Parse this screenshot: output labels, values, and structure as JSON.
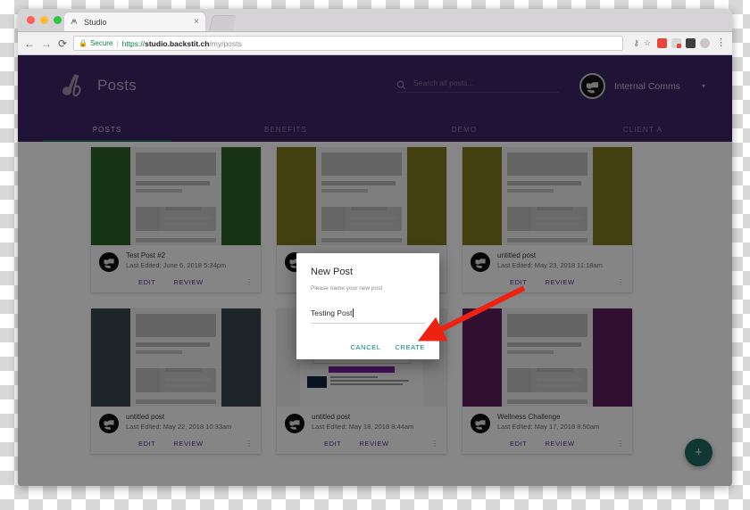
{
  "browser": {
    "tab_title": "Studio",
    "tab_close": "×",
    "back_icon": "back-arrow-icon",
    "forward_icon": "forward-arrow-icon",
    "reload_icon": "C",
    "lock_icon": "lock-icon",
    "secure_label": "Secure",
    "url_separator": "|",
    "url_scheme": "https://",
    "url_host": "studio.backstit.ch",
    "url_path": "/my/posts",
    "key_icon": "key-icon",
    "star_icon": "star-icon",
    "menu_icon": "⋮"
  },
  "app": {
    "brand_title": "Posts",
    "search": {
      "placeholder": "Search all posts...",
      "value": ""
    },
    "user": {
      "name": "Internal Comms",
      "caret": "▾"
    },
    "tabs": [
      {
        "label": "POSTS",
        "active": true
      },
      {
        "label": "BENEFITS",
        "active": false
      },
      {
        "label": "DEMO",
        "active": false
      },
      {
        "label": "CLIENT A",
        "active": false
      }
    ],
    "card_actions": {
      "edit": "EDIT",
      "review": "REVIEW",
      "overflow": "⋮"
    },
    "cards": [
      {
        "title": "Test Post #2",
        "date": "Last Edited: June 6, 2018 5:34pm",
        "accent": "#2a6327",
        "kind": "placeholder"
      },
      {
        "title": "",
        "date": "",
        "accent": "#7d7a1d",
        "kind": "placeholder"
      },
      {
        "title": "untitled post",
        "date": "Last Edited: May 23, 2018 11:18am",
        "accent": "#7d7a1d",
        "kind": "placeholder"
      },
      {
        "title": "untitled post",
        "date": "Last Edited: May 22, 2018 10:33am",
        "accent": "#37474f",
        "kind": "placeholder"
      },
      {
        "title": "untitled post",
        "date": "Last Edited: May 18, 2018 8:44am",
        "accent": "#efefef",
        "kind": "survey"
      },
      {
        "title": "Wellness Challenge",
        "date": "Last Edited: May 17, 2018 8:50am",
        "accent": "#5c1e5c",
        "kind": "placeholder"
      }
    ],
    "fab_label": "+"
  },
  "modal": {
    "heading": "New Post",
    "subtext": "Please name your new post",
    "input_value": "Testing Post",
    "cancel_label": "CANCEL",
    "create_label": "CREATE"
  },
  "colors": {
    "header_purple": "#3b2566",
    "tab_underline_green": "#1e6b4f",
    "action_purple": "#5a2d8c",
    "modal_teal": "#00897b",
    "fab_teal": "#1c6b5e",
    "arrow_red": "#ee2211"
  }
}
